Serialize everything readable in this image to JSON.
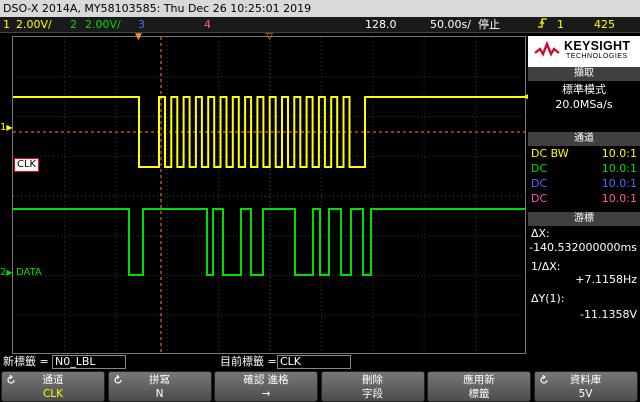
{
  "title_bar": {
    "text": "DSO-X 2014A, MY58103585: Thu Dec 26 10:25:01 2019"
  },
  "status_bar": {
    "ch1": {
      "num": "1",
      "scale": "2.00V/",
      "color": "#ffff00"
    },
    "ch2": {
      "num": "2",
      "scale": "2.00V/",
      "color": "#00dd00"
    },
    "ch3": {
      "num": "3",
      "color": "#4d6cff"
    },
    "ch4": {
      "num": "4",
      "color": "#ff55aa"
    },
    "timebase": "128.0",
    "timescale": "50.00",
    "timescale_unit": "s/",
    "run_state": "停止",
    "trigger_icon": "rising-edge-icon",
    "trigger_source": "1",
    "trigger_level": "425"
  },
  "channels": {
    "ch1_label": "CLK",
    "ch2_label": "DATA",
    "ch1_marker": "1",
    "ch2_marker": "2"
  },
  "right_panel": {
    "logo": {
      "name": "KEYSIGHT",
      "sub": "TECHNOLOGIES"
    },
    "acquire": {
      "header": "擷取",
      "mode": "標準模式",
      "rate": "20.0MSa/s"
    },
    "channel_section": {
      "header": "通道",
      "rows": [
        {
          "coupling": "DC BW",
          "probe": "10.0:1",
          "color": "#ffff00"
        },
        {
          "coupling": "DC",
          "probe": "10.0:1",
          "color": "#00dd00"
        },
        {
          "coupling": "DC",
          "probe": "10.0:1",
          "color": "#4d6cff"
        },
        {
          "coupling": "DC",
          "probe": "10.0:1",
          "color": "#ff55aa"
        }
      ]
    },
    "cursors": {
      "header": "游標",
      "dx_label": "ΔX:",
      "dx_value": "-140.532000000ms",
      "inv_dx_label": "1/ΔX:",
      "inv_dx_value": "+7.1158Hz",
      "dy_label": "ΔY(1):",
      "dy_value": "-11.1358V"
    }
  },
  "labels_row": {
    "new_label_text": "新標籤 =",
    "new_label_value": "N0_LBL",
    "current_label_text": "目前標籤 =",
    "current_label_value": "CLK"
  },
  "softkeys": [
    {
      "label": "通道",
      "value": "CLK",
      "value_color": "#ffff00",
      "knob": true
    },
    {
      "label": "拼寫",
      "value": "N",
      "value_color": "#ffffff",
      "knob": true
    },
    {
      "label": "確認  進格",
      "value": "→",
      "value_color": "#ffffff",
      "knob": false
    },
    {
      "label": "刪除",
      "value": "字段",
      "value_color": "#ffffff",
      "knob": false
    },
    {
      "label": "應用新",
      "value": "標籤",
      "value_color": "#ffffff",
      "knob": false
    },
    {
      "label": "資料庫",
      "value": "5V",
      "value_color": "#ffffff",
      "knob": true
    }
  ]
}
